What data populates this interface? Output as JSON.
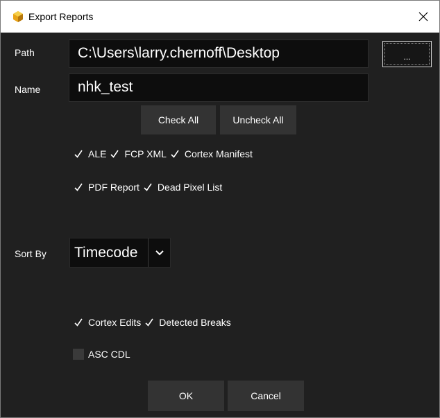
{
  "window": {
    "title": "Export Reports"
  },
  "path": {
    "label": "Path",
    "value": "C:\\Users\\larry.chernoff\\Desktop",
    "browse_label": "..."
  },
  "name": {
    "label": "Name",
    "value": "nhk_test"
  },
  "buttons": {
    "check_all": "Check All",
    "uncheck_all": "Uncheck All",
    "ok": "OK",
    "cancel": "Cancel"
  },
  "reports": {
    "ale": {
      "label": "ALE",
      "checked": true
    },
    "fcp_xml": {
      "label": "FCP XML",
      "checked": true
    },
    "cortex_manifest": {
      "label": "Cortex Manifest",
      "checked": true
    },
    "pdf_report": {
      "label": "PDF Report",
      "checked": true
    },
    "dead_pixel_list": {
      "label": "Dead Pixel List",
      "checked": true
    }
  },
  "sort": {
    "label": "Sort By",
    "value": "Timecode"
  },
  "options": {
    "cortex_edits": {
      "label": "Cortex Edits",
      "checked": true
    },
    "detected_breaks": {
      "label": "Detected Breaks",
      "checked": true
    },
    "asc_cdl": {
      "label": "ASC CDL",
      "checked": false
    }
  },
  "colors": {
    "background": "#202020",
    "field": "#0d0d0d",
    "button": "#333333",
    "icon_accent": "#e8a317"
  }
}
